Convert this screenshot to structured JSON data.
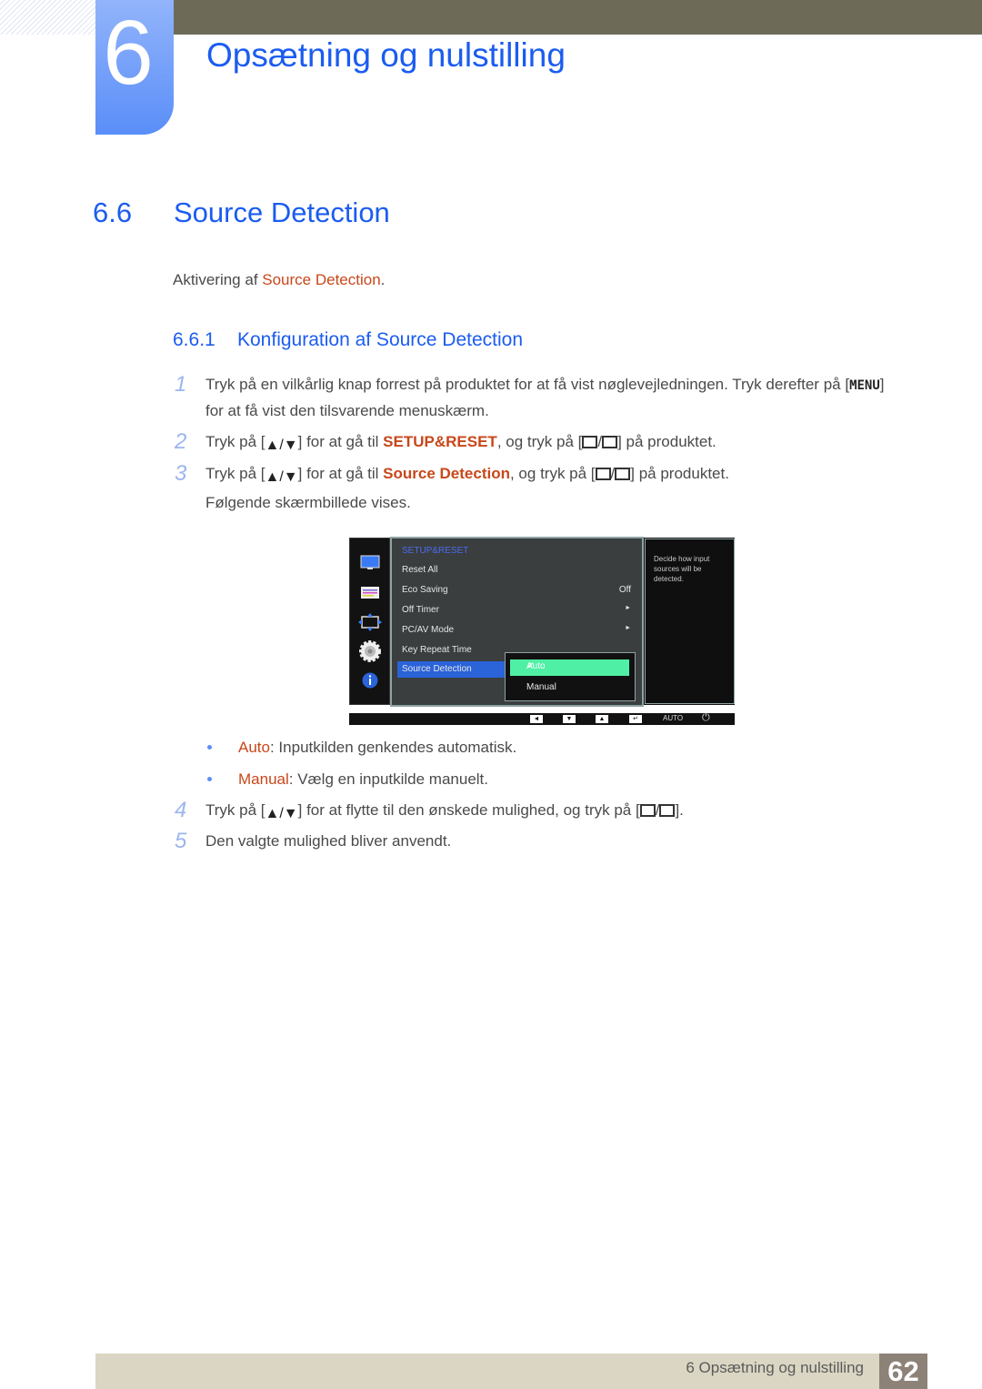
{
  "chapter": {
    "number": "6",
    "title": "Opsætning og nulstilling"
  },
  "section": {
    "number": "6.6",
    "title": "Source Detection"
  },
  "intro": {
    "prefix": "Aktivering af ",
    "highlight": "Source Detection",
    "suffix": "."
  },
  "subsection": {
    "number": "6.6.1",
    "title": "Konfiguration af Source Detection"
  },
  "steps": [
    {
      "n": "1",
      "line1a": "Tryk på en vilkårlig knap forrest på produktet for at få vist nøglevejledningen. Tryk derefter på [",
      "key": "MENU",
      "line1b": "]",
      "line2": "for at få vist den tilsvarende menuskærm."
    },
    {
      "n": "2",
      "a": "Tryk på [",
      "updown": "▲/▼",
      "b": "] for at gå til ",
      "hl": "SETUP&RESET",
      "c": ", og tryk på [",
      "d": "] på produktet."
    },
    {
      "n": "3",
      "a": "Tryk på [",
      "updown": "▲/▼",
      "b": "] for at gå til ",
      "hl": "Source Detection",
      "c": ", og tryk på [",
      "d": "] på produktet.",
      "line2": "Følgende skærmbillede vises."
    },
    {
      "n": "4",
      "a": "Tryk på [",
      "updown": "▲/▼",
      "b": "] for at flytte til den ønskede mulighed, og tryk på [",
      "d": "]."
    },
    {
      "n": "5",
      "a": "Den valgte mulighed bliver anvendt."
    }
  ],
  "osd": {
    "heading": "SETUP&RESET",
    "items": [
      {
        "label": "Reset All",
        "value": ""
      },
      {
        "label": "Eco Saving",
        "value": "Off"
      },
      {
        "label": "Off Timer",
        "value": "►"
      },
      {
        "label": "PC/AV Mode",
        "value": "►"
      },
      {
        "label": "Key Repeat Time",
        "value": ""
      },
      {
        "label": "Source Detection",
        "value": ""
      }
    ],
    "submenu": [
      {
        "label": "Auto",
        "selected": true
      },
      {
        "label": "Manual",
        "selected": false
      }
    ],
    "help": "Decide how input sources will be detected.",
    "bottom_buttons": [
      "◄",
      "▼",
      "▲",
      "↵"
    ],
    "auto_label": "AUTO",
    "power_icon": "⏻"
  },
  "bullets": [
    {
      "hl": "Auto",
      "text": ": Inputkilden genkendes automatisk."
    },
    {
      "hl": "Manual",
      "text": ": Vælg en inputkilde manuelt."
    }
  ],
  "footer": {
    "text": "6 Opsætning og nulstilling",
    "page": "62"
  },
  "colors": {
    "heading_blue": "#1b5cf0",
    "highlight_orange": "#c8471a",
    "osd_green": "#4ff0a6",
    "osd_select_blue": "#2b63d9"
  }
}
